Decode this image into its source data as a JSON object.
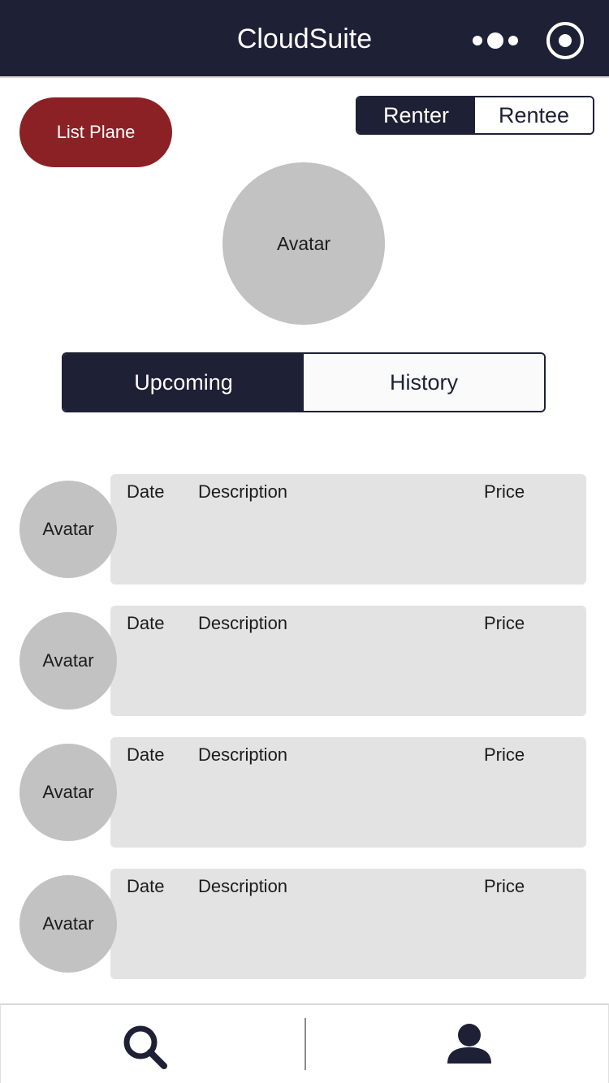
{
  "header": {
    "title": "CloudSuite",
    "more_icon": "more-dots-icon",
    "target_icon": "record-target-icon",
    "background": "#1e2035"
  },
  "actions": {
    "list_plane_label": "List Plane",
    "list_plane_color": "#8c2125"
  },
  "role_toggle": {
    "options": [
      "Renter",
      "Rentee"
    ],
    "selected": "Renter"
  },
  "profile": {
    "avatar_label": "Avatar"
  },
  "tabs": {
    "items": [
      "Upcoming",
      "History"
    ],
    "selected": "Upcoming"
  },
  "bookings": [
    {
      "avatar": "Avatar",
      "date": "Date",
      "description": "Description",
      "price": "Price"
    },
    {
      "avatar": "Avatar",
      "date": "Date",
      "description": "Description",
      "price": "Price"
    },
    {
      "avatar": "Avatar",
      "date": "Date",
      "description": "Description",
      "price": "Price"
    },
    {
      "avatar": "Avatar",
      "date": "Date",
      "description": "Description",
      "price": "Price"
    }
  ],
  "bottom_nav": {
    "items": [
      {
        "icon": "search-icon"
      },
      {
        "icon": "user-icon"
      }
    ]
  }
}
